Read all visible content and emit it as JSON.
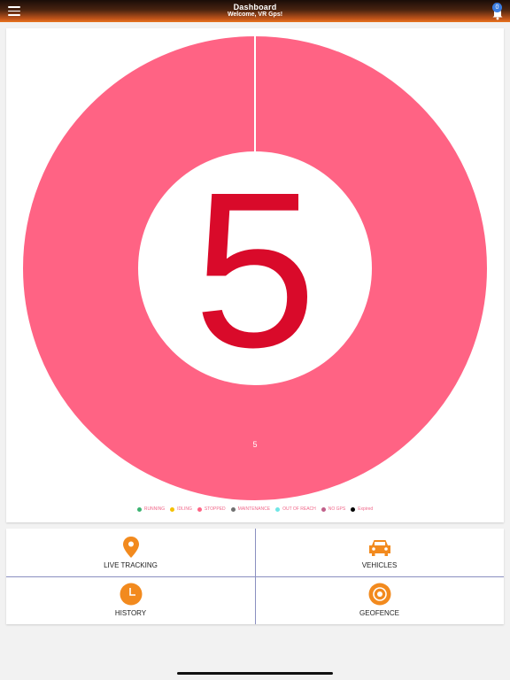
{
  "header": {
    "title": "Dashboard",
    "subtitle": "Welcome, VR Gps!",
    "notification_count": "0"
  },
  "chart_data": {
    "type": "pie",
    "center_total": "5",
    "slice_label": "5",
    "slices": [
      {
        "label": "RUNNING",
        "value": 0,
        "color": "#3cb371"
      },
      {
        "label": "IDLING",
        "value": 0,
        "color": "#f4c000"
      },
      {
        "label": "STOPPED",
        "value": 5,
        "color": "#ff6384"
      },
      {
        "label": "MAINTENANCE",
        "value": 0,
        "color": "#707070"
      },
      {
        "label": "OUT OF REACH",
        "value": 0,
        "color": "#6fe6e6"
      },
      {
        "label": "NO GPS",
        "value": 0,
        "color": "#c0608a"
      },
      {
        "label": "Expired",
        "value": 0,
        "color": "#000000"
      }
    ],
    "center_text_color": "#d90a2a",
    "legend_position": "bottom"
  },
  "tiles": [
    {
      "label": "LIVE TRACKING",
      "icon": "map-pin-icon"
    },
    {
      "label": "VEHICLES",
      "icon": "car-icon"
    },
    {
      "label": "HISTORY",
      "icon": "clock-icon"
    },
    {
      "label": "GEOFENCE",
      "icon": "target-icon"
    }
  ],
  "colors": {
    "accent": "#f28a1e"
  }
}
